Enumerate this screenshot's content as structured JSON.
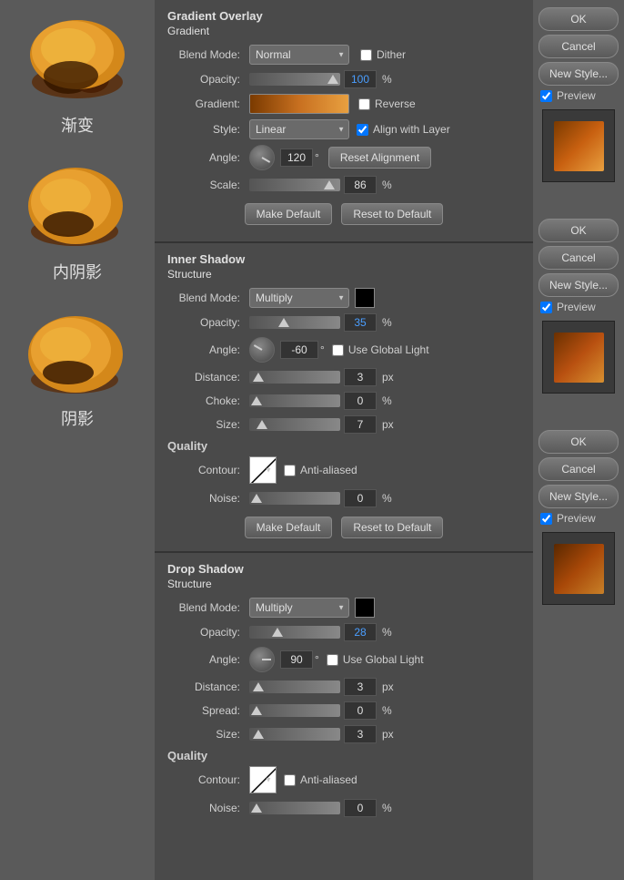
{
  "panels": {
    "gradient_overlay": {
      "title": "Gradient Overlay",
      "subtitle": "Gradient",
      "blend_mode_label": "Blend Mode:",
      "blend_mode_value": "Normal",
      "dither_label": "Dither",
      "opacity_label": "Opacity:",
      "opacity_value": "100",
      "opacity_unit": "%",
      "gradient_label": "Gradient:",
      "reverse_label": "Reverse",
      "style_label": "Style:",
      "style_value": "Linear",
      "align_layer_label": "Align with Layer",
      "angle_label": "Angle:",
      "angle_value": "120",
      "angle_unit": "°",
      "reset_alignment_btn": "Reset Alignment",
      "scale_label": "Scale:",
      "scale_value": "86",
      "scale_unit": "%",
      "make_default_btn": "Make Default",
      "reset_to_default_btn": "Reset to Default"
    },
    "inner_shadow": {
      "title": "Inner Shadow",
      "subtitle": "Structure",
      "blend_mode_label": "Blend Mode:",
      "blend_mode_value": "Multiply",
      "opacity_label": "Opacity:",
      "opacity_value": "35",
      "opacity_unit": "%",
      "angle_label": "Angle:",
      "angle_value": "-60",
      "angle_unit": "°",
      "use_global_light_label": "Use Global Light",
      "distance_label": "Distance:",
      "distance_value": "3",
      "distance_unit": "px",
      "choke_label": "Choke:",
      "choke_value": "0",
      "choke_unit": "%",
      "size_label": "Size:",
      "size_value": "7",
      "size_unit": "px",
      "quality_label": "Quality",
      "contour_label": "Contour:",
      "anti_aliased_label": "Anti-aliased",
      "noise_label": "Noise:",
      "noise_value": "0",
      "noise_unit": "%",
      "make_default_btn": "Make Default",
      "reset_to_default_btn": "Reset to Default"
    },
    "drop_shadow": {
      "title": "Drop Shadow",
      "subtitle": "Structure",
      "blend_mode_label": "Blend Mode:",
      "blend_mode_value": "Multiply",
      "opacity_label": "Opacity:",
      "opacity_value": "28",
      "opacity_unit": "%",
      "angle_label": "Angle:",
      "angle_value": "90",
      "angle_unit": "°",
      "use_global_light_label": "Use Global Light",
      "distance_label": "Distance:",
      "distance_value": "3",
      "distance_unit": "px",
      "spread_label": "Spread:",
      "spread_value": "0",
      "spread_unit": "%",
      "size_label": "Size:",
      "size_value": "3",
      "size_unit": "px",
      "quality_label": "Quality",
      "contour_label": "Contour:",
      "anti_aliased_label": "Anti-aliased",
      "noise_label": "Noise:",
      "noise_value": "0",
      "noise_unit": "%"
    }
  },
  "right_panel": {
    "ok_btn": "OK",
    "cancel_btn": "Cancel",
    "new_style_btn": "New Style...",
    "preview_label": "Preview"
  },
  "left_panel": {
    "label1": "渐变",
    "label2": "内阴影",
    "label3": "阴影"
  }
}
